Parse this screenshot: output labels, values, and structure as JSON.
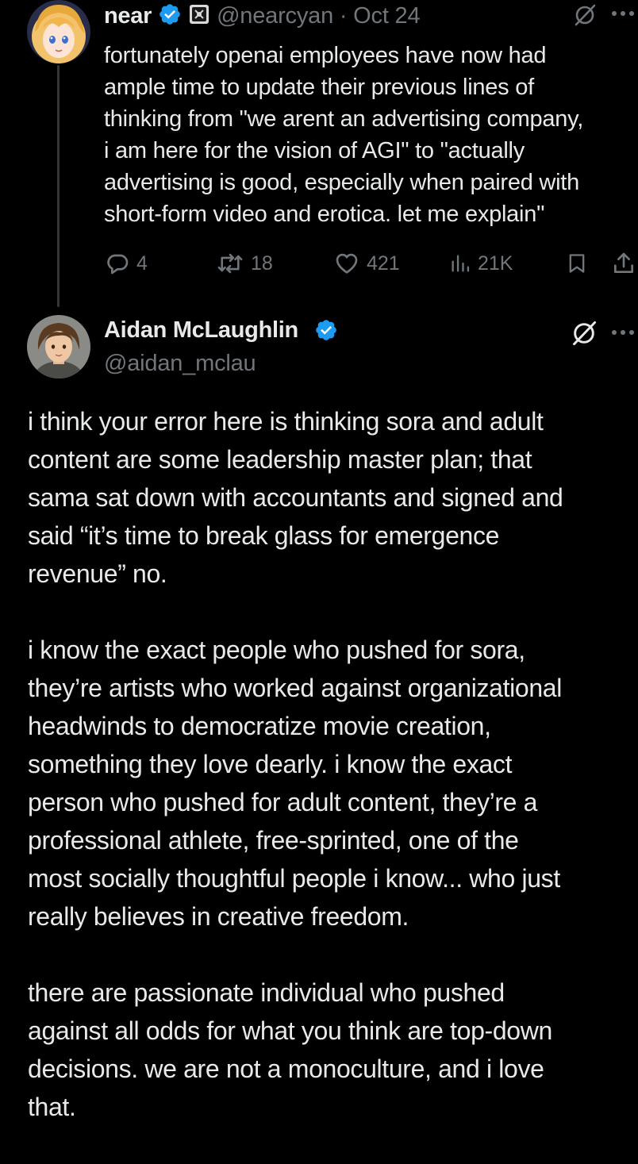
{
  "colors": {
    "background": "#000000",
    "text": "#e7e9ea",
    "muted": "#71767b",
    "verified": "#1d9bf0"
  },
  "tweet1": {
    "author_name": "near",
    "handle_date": "@nearcyan · Oct 24",
    "avatar_icon": "anime-avatar-icon",
    "body_lines": [
      "fortunately openai employees have now had",
      "ample time to update their previous lines of",
      "thinking from \"we arent an advertising company,",
      "i am here for the vision of AGI\" to \"actually",
      "advertising is good, especially when paired with",
      "short-form video and erotica. let me explain\""
    ],
    "replies": "4",
    "reposts": "18",
    "likes": "421",
    "views": "21K"
  },
  "tweet2": {
    "author_name": "Aidan McLaughlin",
    "handle": "@aidan_mclau",
    "avatar_icon": "illustrated-avatar-icon",
    "paragraphs": [
      [
        "i think your error here is thinking sora and adult",
        "content are some leadership master plan; that",
        "sama sat down with accountants and signed and",
        "said “it’s time to break glass for emergence",
        "revenue” no."
      ],
      [
        "i know the exact people who pushed for sora,",
        "they’re artists who worked against organizational",
        "headwinds to democratize movie creation,",
        "something they love dearly. i know the exact",
        "person who pushed for adult content, they’re a",
        "professional athlete, free-sprinted, one of the",
        "most socially thoughtful people i know... who just",
        "really believes in creative freedom."
      ],
      [
        "there are passionate individual who pushed",
        "against all odds for what you think are top-down",
        "decisions. we are not a monoculture, and i love",
        "that."
      ]
    ]
  }
}
